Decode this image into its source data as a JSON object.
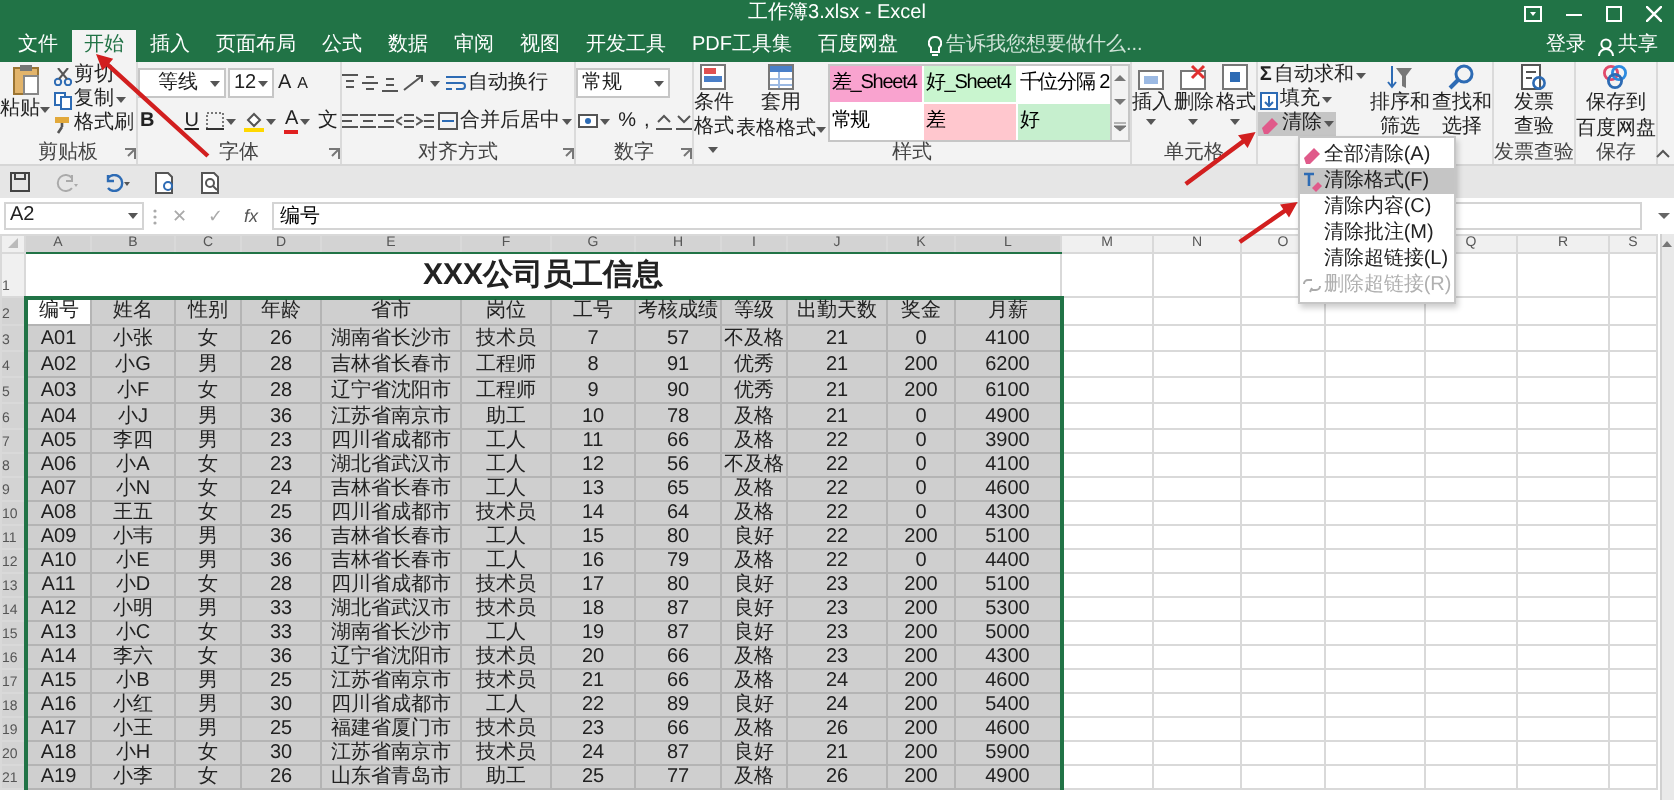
{
  "window": {
    "title": "工作簿3.xlsx - Excel"
  },
  "tabs": [
    {
      "label": "文件",
      "selected": false
    },
    {
      "label": "开始",
      "selected": true
    },
    {
      "label": "插入",
      "selected": false
    },
    {
      "label": "页面布局",
      "selected": false
    },
    {
      "label": "公式",
      "selected": false
    },
    {
      "label": "数据",
      "selected": false
    },
    {
      "label": "审阅",
      "selected": false
    },
    {
      "label": "视图",
      "selected": false
    },
    {
      "label": "开发工具",
      "selected": false
    },
    {
      "label": "PDF工具集",
      "selected": false
    },
    {
      "label": "百度网盘",
      "selected": false
    }
  ],
  "search": {
    "placeholder": "告诉我您想要做什么..."
  },
  "account": {
    "sign_in": "登录",
    "share": "共享"
  },
  "ribbon": {
    "clipboard": {
      "label": "剪贴板",
      "paste": "粘贴",
      "cut": "剪切",
      "copy": "复制",
      "format_painter": "格式刷"
    },
    "font": {
      "label": "字体",
      "font_name": "等线",
      "font_size": "12",
      "grow": "A",
      "shrink": "A",
      "bold": "B",
      "underline": "U",
      "font_color": "A",
      "phonetic": "文"
    },
    "alignment": {
      "label": "对齐方式",
      "wrap_text": "自动换行",
      "merge_center": "合并后居中"
    },
    "number": {
      "label": "数字",
      "format": "常规",
      "percent": "%",
      "comma": ","
    },
    "styles": {
      "label": "样式",
      "conditional": "条件格式",
      "table_format": [
        "套用",
        "表格格式"
      ],
      "gallery": [
        {
          "label": "差_Sheet4",
          "color": "#f9a3cf"
        },
        {
          "label": "好_Sheet4",
          "color": "#c9f5cf"
        },
        {
          "label": "千位分隔 2",
          "color": "#ffffff"
        },
        {
          "label": "常规",
          "color": "#ffffff"
        },
        {
          "label": "差",
          "color": "#ffc7ce"
        },
        {
          "label": "好",
          "color": "#c6efce"
        }
      ]
    },
    "cells": {
      "label": "单元格",
      "insert": "插入",
      "delete": "删除",
      "format": "格式"
    },
    "editing": {
      "autosum_symbol": "Σ",
      "autosum": "自动求和",
      "fill": "填充",
      "clear": "清除",
      "clear_expanded": true,
      "sort_filter": "排序和筛选",
      "find_select": "查找和选择"
    },
    "invoice": {
      "label": "发票查验",
      "button": "发票查验"
    },
    "save": {
      "label": "保存",
      "button": [
        "保存到",
        "百度网盘"
      ]
    }
  },
  "clear_menu": [
    {
      "label": "全部清除(A)",
      "selected": false,
      "disabled": false
    },
    {
      "label": "清除格式(F)",
      "selected": true,
      "disabled": false
    },
    {
      "label": "清除内容(C)",
      "selected": false,
      "disabled": false
    },
    {
      "label": "清除批注(M)",
      "selected": false,
      "disabled": false
    },
    {
      "label": "清除超链接(L)",
      "selected": false,
      "disabled": false
    },
    {
      "label": "删除超链接(R)",
      "selected": false,
      "disabled": true
    }
  ],
  "formula_bar": {
    "name_box": "A2",
    "cancel": "✕",
    "enter": "✓",
    "fx": "fx",
    "content": "编号"
  },
  "sheet": {
    "columns": [
      {
        "label": "A",
        "selected": true
      },
      {
        "label": "B",
        "selected": true
      },
      {
        "label": "C",
        "selected": true
      },
      {
        "label": "D",
        "selected": true
      },
      {
        "label": "E",
        "selected": true
      },
      {
        "label": "F",
        "selected": true
      },
      {
        "label": "G",
        "selected": true
      },
      {
        "label": "H",
        "selected": true
      },
      {
        "label": "I",
        "selected": true
      },
      {
        "label": "J",
        "selected": true
      },
      {
        "label": "K",
        "selected": true
      },
      {
        "label": "L",
        "selected": true
      },
      {
        "label": "M",
        "selected": false
      },
      {
        "label": "N",
        "selected": false
      },
      {
        "label": "O",
        "selected": false
      },
      null,
      {
        "label": "Q",
        "selected": false
      },
      {
        "label": "R",
        "selected": false
      },
      {
        "label": "S",
        "selected": false
      }
    ],
    "title": "XXX公司员工信息",
    "header": [
      {
        "text": "编号",
        "selected": true
      },
      {
        "text": "姓名",
        "selected": false
      },
      {
        "text": "性别",
        "selected": false
      },
      {
        "text": "年龄",
        "selected": false
      },
      {
        "text": "省市",
        "selected": false
      },
      {
        "text": "岗位",
        "selected": false
      },
      {
        "text": "工号",
        "selected": false
      },
      {
        "text": "考核成绩",
        "selected": false
      },
      {
        "text": "等级",
        "selected": false
      },
      {
        "text": "出勤天数",
        "selected": false
      },
      {
        "text": "奖金",
        "selected": false
      },
      {
        "text": "月薪",
        "selected": false
      }
    ],
    "rows": [
      [
        "A01",
        "小张",
        "女",
        "26",
        "湖南省长沙市",
        "技术员",
        "7",
        "57",
        "不及格",
        "21",
        "0",
        "4100"
      ],
      [
        "A02",
        "小G",
        "男",
        "28",
        "吉林省长春市",
        "工程师",
        "8",
        "91",
        "优秀",
        "21",
        "200",
        "6200"
      ],
      [
        "A03",
        "小F",
        "女",
        "28",
        "辽宁省沈阳市",
        "工程师",
        "9",
        "90",
        "优秀",
        "21",
        "200",
        "6100"
      ],
      [
        "A04",
        "小J",
        "男",
        "36",
        "江苏省南京市",
        "助工",
        "10",
        "78",
        "及格",
        "21",
        "0",
        "4900"
      ],
      [
        "A05",
        "李四",
        "男",
        "23",
        "四川省成都市",
        "工人",
        "11",
        "66",
        "及格",
        "22",
        "0",
        "3900"
      ],
      [
        "A06",
        "小A",
        "女",
        "23",
        "湖北省武汉市",
        "工人",
        "12",
        "56",
        "不及格",
        "22",
        "0",
        "4100"
      ],
      [
        "A07",
        "小N",
        "女",
        "24",
        "吉林省长春市",
        "工人",
        "13",
        "65",
        "及格",
        "22",
        "0",
        "4600"
      ],
      [
        "A08",
        "王五",
        "女",
        "25",
        "四川省成都市",
        "技术员",
        "14",
        "64",
        "及格",
        "22",
        "0",
        "4300"
      ],
      [
        "A09",
        "小韦",
        "男",
        "36",
        "吉林省长春市",
        "工人",
        "15",
        "80",
        "良好",
        "22",
        "200",
        "5100"
      ],
      [
        "A10",
        "小E",
        "男",
        "36",
        "吉林省长春市",
        "工人",
        "16",
        "79",
        "及格",
        "22",
        "0",
        "4400"
      ],
      [
        "A11",
        "小D",
        "女",
        "28",
        "四川省成都市",
        "技术员",
        "17",
        "80",
        "良好",
        "23",
        "200",
        "5100"
      ],
      [
        "A12",
        "小明",
        "男",
        "33",
        "湖北省武汉市",
        "技术员",
        "18",
        "87",
        "良好",
        "23",
        "200",
        "5300"
      ],
      [
        "A13",
        "小C",
        "女",
        "33",
        "湖南省长沙市",
        "工人",
        "19",
        "87",
        "良好",
        "23",
        "200",
        "5000"
      ],
      [
        "A14",
        "李六",
        "女",
        "36",
        "辽宁省沈阳市",
        "技术员",
        "20",
        "66",
        "及格",
        "23",
        "200",
        "4300"
      ],
      [
        "A15",
        "小B",
        "男",
        "25",
        "江苏省南京市",
        "技术员",
        "21",
        "66",
        "及格",
        "24",
        "200",
        "4600"
      ],
      [
        "A16",
        "小红",
        "男",
        "30",
        "四川省成都市",
        "工人",
        "22",
        "89",
        "良好",
        "24",
        "200",
        "5400"
      ],
      [
        "A17",
        "小王",
        "男",
        "25",
        "福建省厦门市",
        "技术员",
        "23",
        "66",
        "及格",
        "26",
        "200",
        "4600"
      ],
      [
        "A18",
        "小H",
        "女",
        "30",
        "江苏省南京市",
        "技术员",
        "24",
        "87",
        "良好",
        "21",
        "200",
        "5900"
      ],
      [
        "A19",
        "小李",
        "女",
        "26",
        "山东省青岛市",
        "助工",
        "25",
        "77",
        "及格",
        "26",
        "200",
        "4900"
      ]
    ],
    "row_numbers": [
      {
        "label": "1",
        "selected": false
      },
      {
        "label": "2",
        "selected": true
      },
      {
        "label": "3",
        "selected": true
      },
      {
        "label": "4",
        "selected": true
      },
      {
        "label": "5",
        "selected": true
      },
      {
        "label": "6",
        "selected": true
      },
      {
        "label": "7",
        "selected": true
      },
      {
        "label": "8",
        "selected": true
      },
      {
        "label": "9",
        "selected": true
      },
      {
        "label": "10",
        "selected": true
      },
      {
        "label": "11",
        "selected": true
      },
      {
        "label": "12",
        "selected": true
      },
      {
        "label": "13",
        "selected": true
      },
      {
        "label": "14",
        "selected": true
      },
      {
        "label": "15",
        "selected": true
      },
      {
        "label": "16",
        "selected": true
      },
      {
        "label": "17",
        "selected": true
      },
      {
        "label": "18",
        "selected": true
      },
      {
        "label": "19",
        "selected": true
      },
      {
        "label": "20",
        "selected": true
      },
      {
        "label": "21",
        "selected": true
      }
    ]
  }
}
